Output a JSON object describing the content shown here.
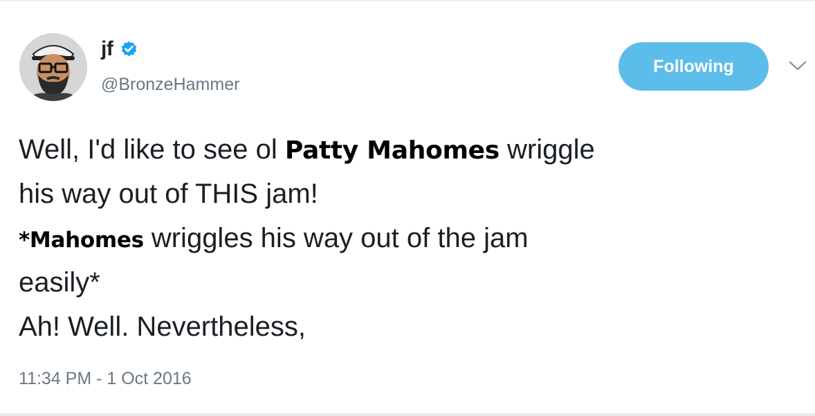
{
  "user": {
    "display_name": "jf",
    "handle": "@BronzeHammer",
    "verified": true,
    "avatar_icon": "bearded-man-with-hat-avatar-icon"
  },
  "follow_button": {
    "label": "Following"
  },
  "menu_icon": "chevron-down-icon",
  "tweet": {
    "line1": {
      "a": "Well, I'd like to see ol ",
      "overlay": "Patty Mahomes",
      "b": " wriggle"
    },
    "line2": "his way out of THIS jam!",
    "line3": {
      "overlay": "*Mahomes",
      "b": " wriggles his way out of the jam"
    },
    "line4": "easily*",
    "line5": "Ah! Well. Nevertheless,"
  },
  "timestamp": "11:34 PM - 1 Oct 2016",
  "colors": {
    "follow_button": "#5dbdea",
    "verified_badge": "#1da1f2",
    "secondary_text": "#6b7782"
  }
}
